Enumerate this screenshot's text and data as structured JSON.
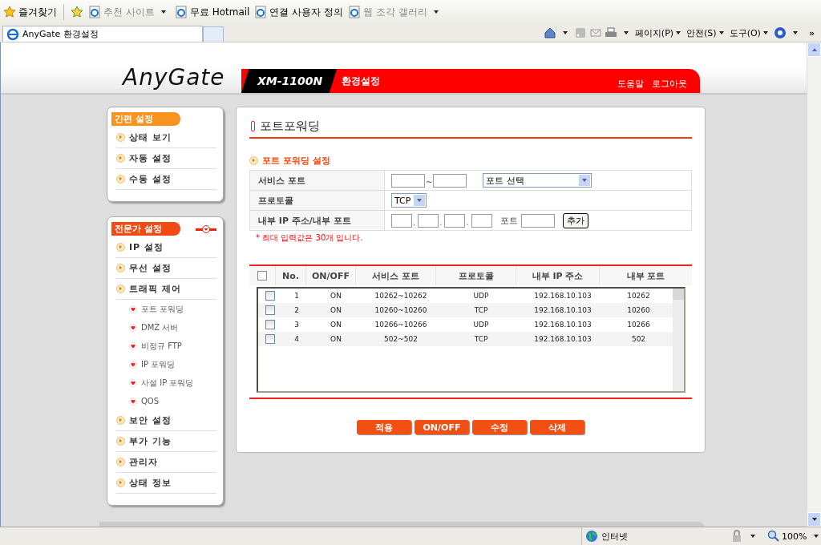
{
  "browser": {
    "favorites_label": "즐겨찾기",
    "favorites": [
      {
        "label": "추천 사이트",
        "disabled": true,
        "dropdown": true
      },
      {
        "label": "무료 Hotmail",
        "disabled": false,
        "dropdown": false
      },
      {
        "label": "연결 사용자 정의",
        "disabled": false,
        "dropdown": false
      },
      {
        "label": "웹 조각 갤러리",
        "disabled": true,
        "dropdown": true
      }
    ],
    "tab_title": "AnyGate 환경설정",
    "commands": [
      "페이지(P)",
      "안전(S)",
      "도구(O)"
    ],
    "chevron": "»"
  },
  "header": {
    "logo": "AnyGate",
    "model": "XM-1100N",
    "section": "환경설정",
    "links": [
      "도움말",
      "로그아웃"
    ]
  },
  "sidebar": [
    {
      "title": "간편 설정",
      "collapsible": false,
      "items": [
        {
          "label": "상태 보기"
        },
        {
          "label": "자동 설정"
        },
        {
          "label": "수동 설정"
        }
      ]
    },
    {
      "title": "전문가 설정",
      "collapsible": true,
      "items": [
        {
          "label": "IP 설정"
        },
        {
          "label": "무선 설정"
        },
        {
          "label": "트래픽 제어",
          "children": [
            {
              "label": "포트 포워딩"
            },
            {
              "label": "DMZ 서버"
            },
            {
              "label": "비정규 FTP"
            },
            {
              "label": "IP 포워딩"
            },
            {
              "label": "사설 IP 포워딩"
            },
            {
              "label": "QOS"
            }
          ]
        },
        {
          "label": "보안 설정"
        },
        {
          "label": "부가 기능"
        },
        {
          "label": "관리자"
        },
        {
          "label": "상태 정보"
        }
      ]
    }
  ],
  "page_title": "포트포워딩",
  "section_title": "포트 포워딩 설정",
  "form": {
    "service_port_label": "서비스 포트",
    "range_sep": "~",
    "port_select": "포트 선택",
    "protocol_label": "프로토콜",
    "protocol": "TCP",
    "internal_label": "내부 IP 주소/내부 포트",
    "ip_sep": ".",
    "port_label": "포트",
    "add_button": "추가",
    "note": "* 최대 입력값은 30개 입니다."
  },
  "table": {
    "all_checked": false,
    "columns": [
      "No.",
      "ON/OFF",
      "서비스 포트",
      "프로토콜",
      "내부 IP 주소",
      "내부 포트"
    ],
    "rows": [
      {
        "checked": false,
        "cells": [
          "1",
          "ON",
          "10262~10262",
          "UDP",
          "192.168.10.103",
          "10262"
        ]
      },
      {
        "checked": false,
        "cells": [
          "2",
          "ON",
          "10260~10260",
          "TCP",
          "192.168.10.103",
          "10260"
        ]
      },
      {
        "checked": false,
        "cells": [
          "3",
          "ON",
          "10266~10266",
          "UDP",
          "192.168.10.103",
          "10266"
        ]
      },
      {
        "checked": false,
        "cells": [
          "4",
          "ON",
          "502~502",
          "TCP",
          "192.168.10.103",
          "502"
        ]
      }
    ]
  },
  "actions": [
    "적용",
    "ON/OFF",
    "수정",
    "삭제"
  ],
  "status_bar": {
    "zone": "인터넷",
    "zoom": "100%"
  }
}
